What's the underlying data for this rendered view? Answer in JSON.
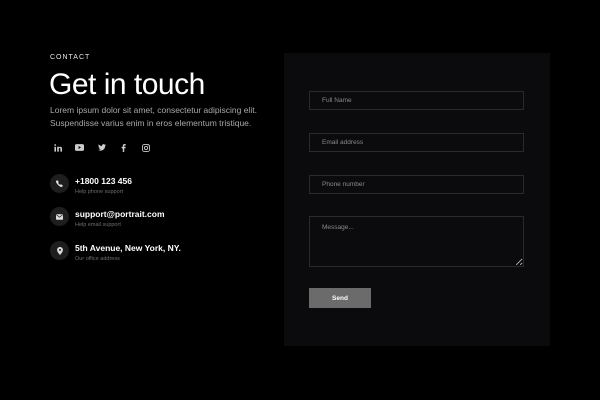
{
  "header": {
    "eyebrow": "CONTACT",
    "title": "Get in touch",
    "description": "Lorem ipsum dolor sit amet, consectetur adipiscing elit. Suspendisse varius enim in eros elementum tristique."
  },
  "socials": [
    {
      "name": "linkedin-icon"
    },
    {
      "name": "youtube-icon"
    },
    {
      "name": "twitter-icon"
    },
    {
      "name": "facebook-icon"
    },
    {
      "name": "instagram-icon"
    }
  ],
  "contacts": {
    "phone": {
      "value": "+1800 123 456",
      "caption": "Help phone support",
      "icon": "phone-icon"
    },
    "email": {
      "value": "support@portrait.com",
      "caption": "Help email support",
      "icon": "mail-icon"
    },
    "address": {
      "value": "5th Avenue, New York, NY.",
      "caption": "Our office address",
      "icon": "location-pin-icon"
    }
  },
  "form": {
    "full_name": {
      "placeholder": "Full Name",
      "value": ""
    },
    "email": {
      "placeholder": "Email address",
      "value": ""
    },
    "phone": {
      "placeholder": "Phone number",
      "value": ""
    },
    "message": {
      "placeholder": "Message...",
      "value": ""
    },
    "send_label": "Send"
  },
  "colors": {
    "background": "#000000",
    "panel": "#0b0b0d",
    "field_border": "#2a2a2d",
    "button": "#6b6b6b",
    "muted_text": "#a8a8a8"
  }
}
